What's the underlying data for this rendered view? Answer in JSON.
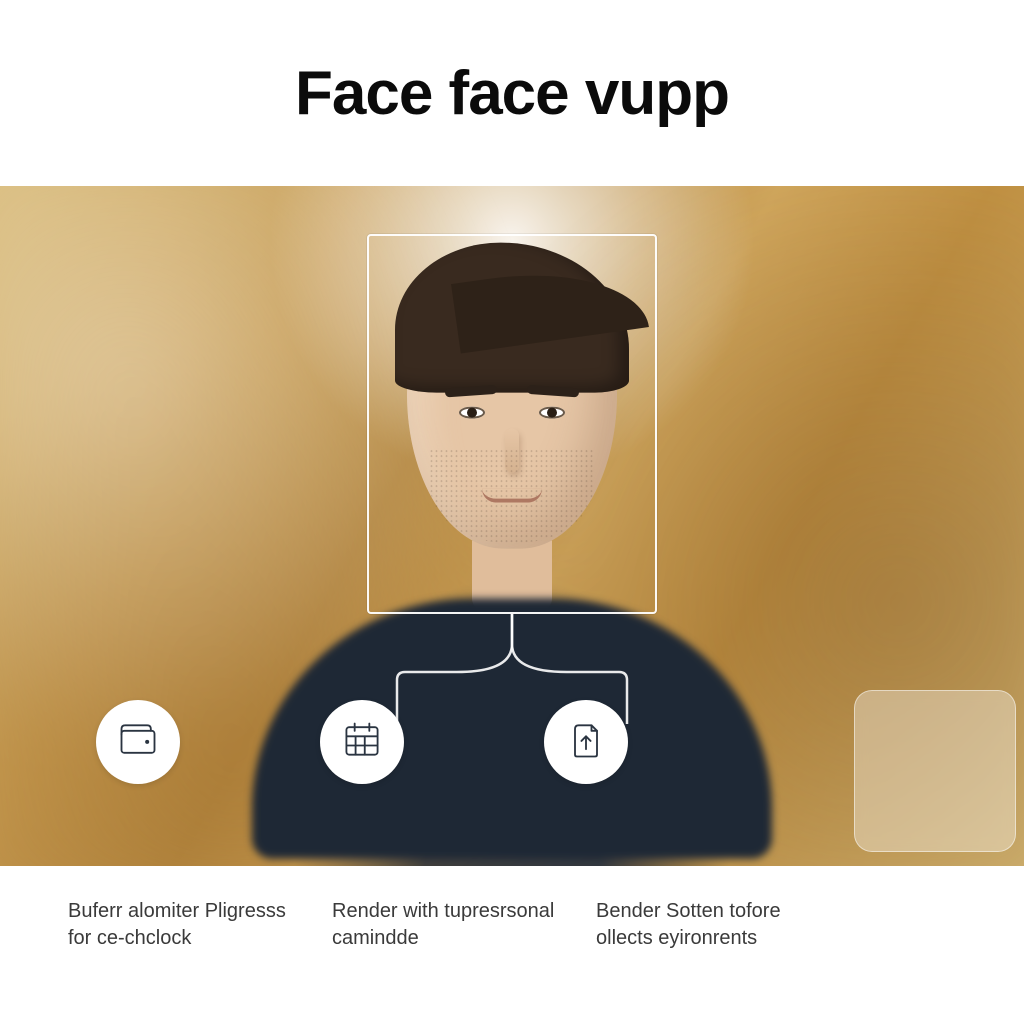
{
  "title": "Face face vupp",
  "face_box": {
    "aria": "face-detection-frame"
  },
  "features": [
    {
      "icon": "wallet-icon",
      "caption": "Buferr alomiter Pligresss for ce-chclock"
    },
    {
      "icon": "calendar-icon",
      "caption": "Render with tupresrsonal camindde"
    },
    {
      "icon": "upload-icon",
      "caption": "Bender Sotten tofore ollects eyironrents"
    }
  ],
  "panel": {
    "label": ""
  }
}
